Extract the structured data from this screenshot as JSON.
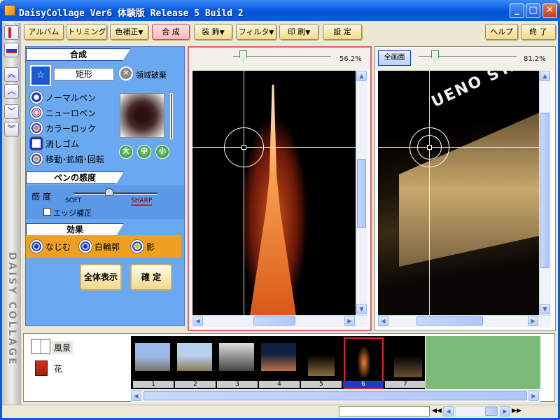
{
  "window": {
    "title": "DaisyCollage Ver6 体験版 Release 5 Build 2"
  },
  "toolbar": {
    "album": "アルバム",
    "trimming": "トリミング",
    "color": "色補正",
    "composite": "合 成",
    "decorate": "装 飾",
    "filter": "フィルタ",
    "print": "印 刷",
    "settings": "設 定",
    "help": "ヘルプ",
    "exit": "終 了",
    "dropdown_arrow": "▼"
  },
  "side_logo": "DAISY COLLAGE",
  "panel": {
    "header": "合成",
    "shape_label": "矩形",
    "discard_label": "領域破棄",
    "pens": [
      {
        "label": "ノーマルペン"
      },
      {
        "label": "ニューロペン"
      },
      {
        "label": "カラーロック"
      },
      {
        "label": "消しゴム"
      },
      {
        "label": "移動･拡縮･回転"
      }
    ],
    "sizes": [
      "大",
      "中",
      "小"
    ],
    "sensitivity_header": "ペンの感度",
    "sensitivity_label": "感 度",
    "soft": "SOFT",
    "sharp": "SHARP",
    "edge_label": "エッジ補正",
    "effect_header": "効果",
    "effects": [
      {
        "label": "なじむ"
      },
      {
        "label": "白輪郭"
      },
      {
        "label": "影"
      }
    ],
    "show_all": "全体表示",
    "confirm": "確 定"
  },
  "left_pane": {
    "zoom": "56.2%"
  },
  "right_pane": {
    "zoom": "81.2%",
    "fullscreen": "全画面",
    "sign_text": "UENO STATI"
  },
  "album": {
    "categories": [
      {
        "label": "風景"
      },
      {
        "label": "花"
      }
    ]
  },
  "filmstrip": {
    "frames": [
      {
        "num": "1"
      },
      {
        "num": "2"
      },
      {
        "num": "3"
      },
      {
        "num": "4"
      },
      {
        "num": "5"
      },
      {
        "num": "6"
      },
      {
        "num": "7"
      }
    ],
    "selected": 5
  },
  "colors": {
    "title_blue": "#0a5ce6",
    "panel_blue": "#6aa8f0",
    "effect_orange": "#f0a020",
    "film_green": "#7cba78"
  }
}
